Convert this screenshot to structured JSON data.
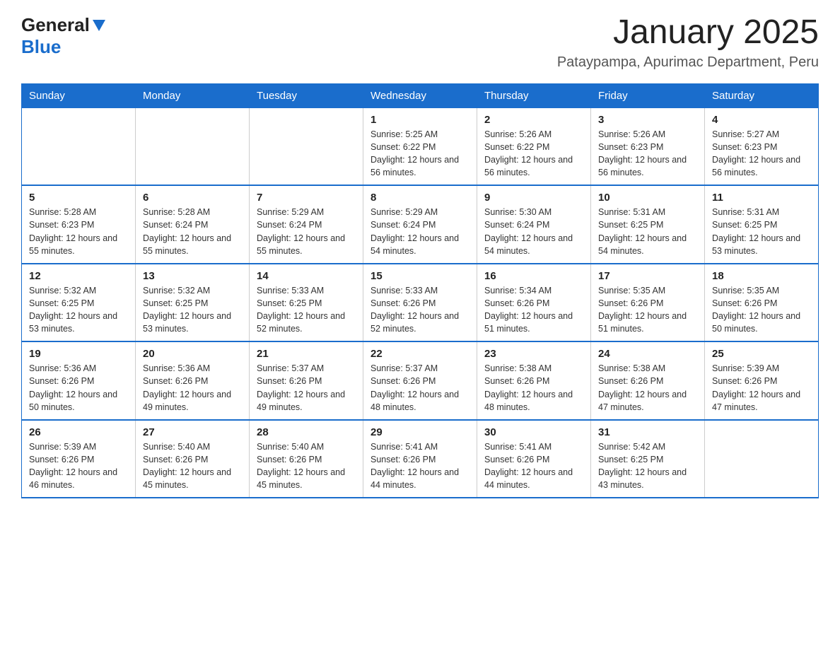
{
  "header": {
    "logo_general": "General",
    "logo_blue": "Blue",
    "title": "January 2025",
    "subtitle": "Pataypampa, Apurimac Department, Peru"
  },
  "days_of_week": [
    "Sunday",
    "Monday",
    "Tuesday",
    "Wednesday",
    "Thursday",
    "Friday",
    "Saturday"
  ],
  "weeks": [
    [
      {
        "day": "",
        "info": ""
      },
      {
        "day": "",
        "info": ""
      },
      {
        "day": "",
        "info": ""
      },
      {
        "day": "1",
        "info": "Sunrise: 5:25 AM\nSunset: 6:22 PM\nDaylight: 12 hours and 56 minutes."
      },
      {
        "day": "2",
        "info": "Sunrise: 5:26 AM\nSunset: 6:22 PM\nDaylight: 12 hours and 56 minutes."
      },
      {
        "day": "3",
        "info": "Sunrise: 5:26 AM\nSunset: 6:23 PM\nDaylight: 12 hours and 56 minutes."
      },
      {
        "day": "4",
        "info": "Sunrise: 5:27 AM\nSunset: 6:23 PM\nDaylight: 12 hours and 56 minutes."
      }
    ],
    [
      {
        "day": "5",
        "info": "Sunrise: 5:28 AM\nSunset: 6:23 PM\nDaylight: 12 hours and 55 minutes."
      },
      {
        "day": "6",
        "info": "Sunrise: 5:28 AM\nSunset: 6:24 PM\nDaylight: 12 hours and 55 minutes."
      },
      {
        "day": "7",
        "info": "Sunrise: 5:29 AM\nSunset: 6:24 PM\nDaylight: 12 hours and 55 minutes."
      },
      {
        "day": "8",
        "info": "Sunrise: 5:29 AM\nSunset: 6:24 PM\nDaylight: 12 hours and 54 minutes."
      },
      {
        "day": "9",
        "info": "Sunrise: 5:30 AM\nSunset: 6:24 PM\nDaylight: 12 hours and 54 minutes."
      },
      {
        "day": "10",
        "info": "Sunrise: 5:31 AM\nSunset: 6:25 PM\nDaylight: 12 hours and 54 minutes."
      },
      {
        "day": "11",
        "info": "Sunrise: 5:31 AM\nSunset: 6:25 PM\nDaylight: 12 hours and 53 minutes."
      }
    ],
    [
      {
        "day": "12",
        "info": "Sunrise: 5:32 AM\nSunset: 6:25 PM\nDaylight: 12 hours and 53 minutes."
      },
      {
        "day": "13",
        "info": "Sunrise: 5:32 AM\nSunset: 6:25 PM\nDaylight: 12 hours and 53 minutes."
      },
      {
        "day": "14",
        "info": "Sunrise: 5:33 AM\nSunset: 6:25 PM\nDaylight: 12 hours and 52 minutes."
      },
      {
        "day": "15",
        "info": "Sunrise: 5:33 AM\nSunset: 6:26 PM\nDaylight: 12 hours and 52 minutes."
      },
      {
        "day": "16",
        "info": "Sunrise: 5:34 AM\nSunset: 6:26 PM\nDaylight: 12 hours and 51 minutes."
      },
      {
        "day": "17",
        "info": "Sunrise: 5:35 AM\nSunset: 6:26 PM\nDaylight: 12 hours and 51 minutes."
      },
      {
        "day": "18",
        "info": "Sunrise: 5:35 AM\nSunset: 6:26 PM\nDaylight: 12 hours and 50 minutes."
      }
    ],
    [
      {
        "day": "19",
        "info": "Sunrise: 5:36 AM\nSunset: 6:26 PM\nDaylight: 12 hours and 50 minutes."
      },
      {
        "day": "20",
        "info": "Sunrise: 5:36 AM\nSunset: 6:26 PM\nDaylight: 12 hours and 49 minutes."
      },
      {
        "day": "21",
        "info": "Sunrise: 5:37 AM\nSunset: 6:26 PM\nDaylight: 12 hours and 49 minutes."
      },
      {
        "day": "22",
        "info": "Sunrise: 5:37 AM\nSunset: 6:26 PM\nDaylight: 12 hours and 48 minutes."
      },
      {
        "day": "23",
        "info": "Sunrise: 5:38 AM\nSunset: 6:26 PM\nDaylight: 12 hours and 48 minutes."
      },
      {
        "day": "24",
        "info": "Sunrise: 5:38 AM\nSunset: 6:26 PM\nDaylight: 12 hours and 47 minutes."
      },
      {
        "day": "25",
        "info": "Sunrise: 5:39 AM\nSunset: 6:26 PM\nDaylight: 12 hours and 47 minutes."
      }
    ],
    [
      {
        "day": "26",
        "info": "Sunrise: 5:39 AM\nSunset: 6:26 PM\nDaylight: 12 hours and 46 minutes."
      },
      {
        "day": "27",
        "info": "Sunrise: 5:40 AM\nSunset: 6:26 PM\nDaylight: 12 hours and 45 minutes."
      },
      {
        "day": "28",
        "info": "Sunrise: 5:40 AM\nSunset: 6:26 PM\nDaylight: 12 hours and 45 minutes."
      },
      {
        "day": "29",
        "info": "Sunrise: 5:41 AM\nSunset: 6:26 PM\nDaylight: 12 hours and 44 minutes."
      },
      {
        "day": "30",
        "info": "Sunrise: 5:41 AM\nSunset: 6:26 PM\nDaylight: 12 hours and 44 minutes."
      },
      {
        "day": "31",
        "info": "Sunrise: 5:42 AM\nSunset: 6:25 PM\nDaylight: 12 hours and 43 minutes."
      },
      {
        "day": "",
        "info": ""
      }
    ]
  ]
}
